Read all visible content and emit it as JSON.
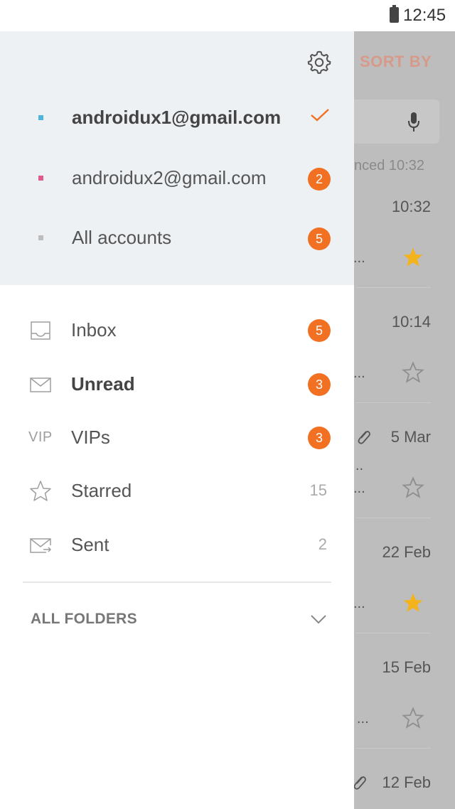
{
  "status_bar": {
    "time": "12:45"
  },
  "background_list": {
    "sort_by": "SORT BY",
    "synced": "nced 10:32",
    "rows": [
      {
        "time": "10:32",
        "starred": true
      },
      {
        "time": "10:14",
        "starred": false
      },
      {
        "time": "5 Mar",
        "starred": false,
        "attachment": true
      },
      {
        "time": "22 Feb",
        "starred": true
      },
      {
        "time": "15 Feb",
        "starred": false
      },
      {
        "time": "12 Feb",
        "attachment": true
      }
    ],
    "ellipsis": "..."
  },
  "drawer": {
    "accounts": [
      {
        "label": "androidux1@gmail.com",
        "color": "#4db6d9",
        "selected": true
      },
      {
        "label": "androidux2@gmail.com",
        "color": "#e05a8a",
        "badge": "2"
      },
      {
        "label": "All accounts",
        "color": "#bdbdbd",
        "badge": "5"
      }
    ],
    "folders": [
      {
        "label": "Inbox",
        "icon": "inbox-icon",
        "badge": "5"
      },
      {
        "label": "Unread",
        "icon": "envelope-icon",
        "badge": "3"
      },
      {
        "label": "VIPs",
        "icon": "vip-icon",
        "icon_text": "VIP",
        "badge": "3"
      },
      {
        "label": "Starred",
        "icon": "star-icon",
        "count": "15"
      },
      {
        "label": "Sent",
        "icon": "sent-icon",
        "count": "2"
      }
    ],
    "all_folders": "ALL FOLDERS"
  },
  "colors": {
    "accent": "#f27022",
    "star_filled": "#f2b31c",
    "drawer_header_bg": "#eef1f4"
  }
}
